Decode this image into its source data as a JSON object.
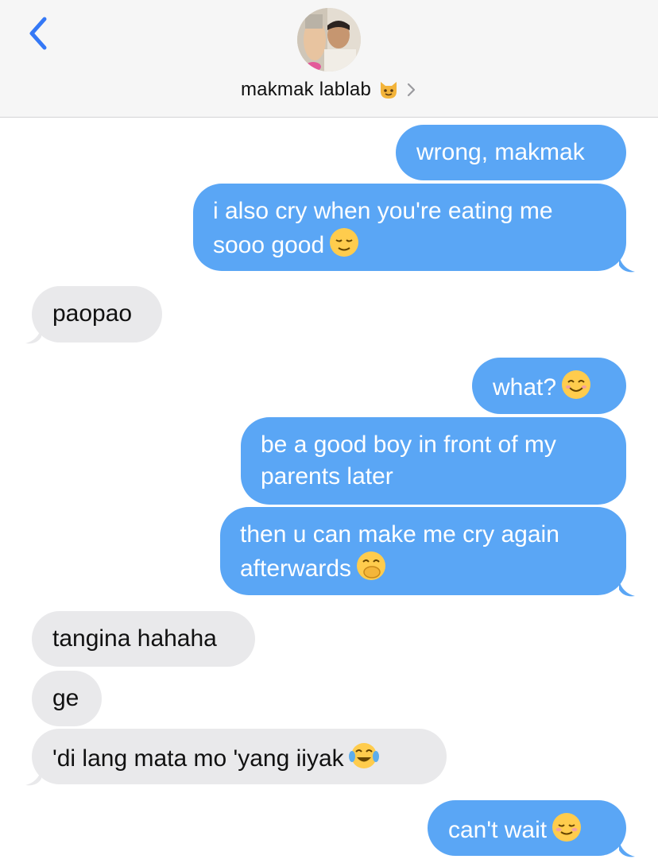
{
  "header": {
    "contact_name": "makmak lablab",
    "contact_emoji": "cat-emoji-icon",
    "back_icon": "chevron-left-icon",
    "details_icon": "chevron-right-icon",
    "accent_color": "#3478f6"
  },
  "messages": [
    {
      "dir": "out",
      "line1": "wrong, makmak",
      "line2": "",
      "emoji": ""
    },
    {
      "dir": "out",
      "line1": "i also cry when you're eating me",
      "line2": "sooo good",
      "emoji": "relieved-face-icon"
    },
    {
      "dir": "in",
      "line1": "paopao",
      "line2": "",
      "emoji": ""
    },
    {
      "dir": "out",
      "line1": "what?",
      "line2": "",
      "emoji": "smiling-face-icon"
    },
    {
      "dir": "out",
      "line1": "be a good boy in front of my",
      "line2": "parents later",
      "emoji": ""
    },
    {
      "dir": "out",
      "line1": "then u can make me cry again",
      "line2": "afterwards",
      "emoji": "face-with-hand-over-mouth-icon"
    },
    {
      "dir": "in",
      "line1": "tangina hahaha",
      "line2": "",
      "emoji": ""
    },
    {
      "dir": "in",
      "line1": "ge",
      "line2": "",
      "emoji": ""
    },
    {
      "dir": "in",
      "line1": "'di lang mata mo 'yang iiyak",
      "line2": "",
      "emoji": "tears-of-joy-icon"
    },
    {
      "dir": "out",
      "line1": "can't wait",
      "line2": "",
      "emoji": "smiling-blush-icon"
    }
  ],
  "colors": {
    "outgoing_bubble": "#5aa6f5",
    "incoming_bubble": "#e9e9eb"
  }
}
